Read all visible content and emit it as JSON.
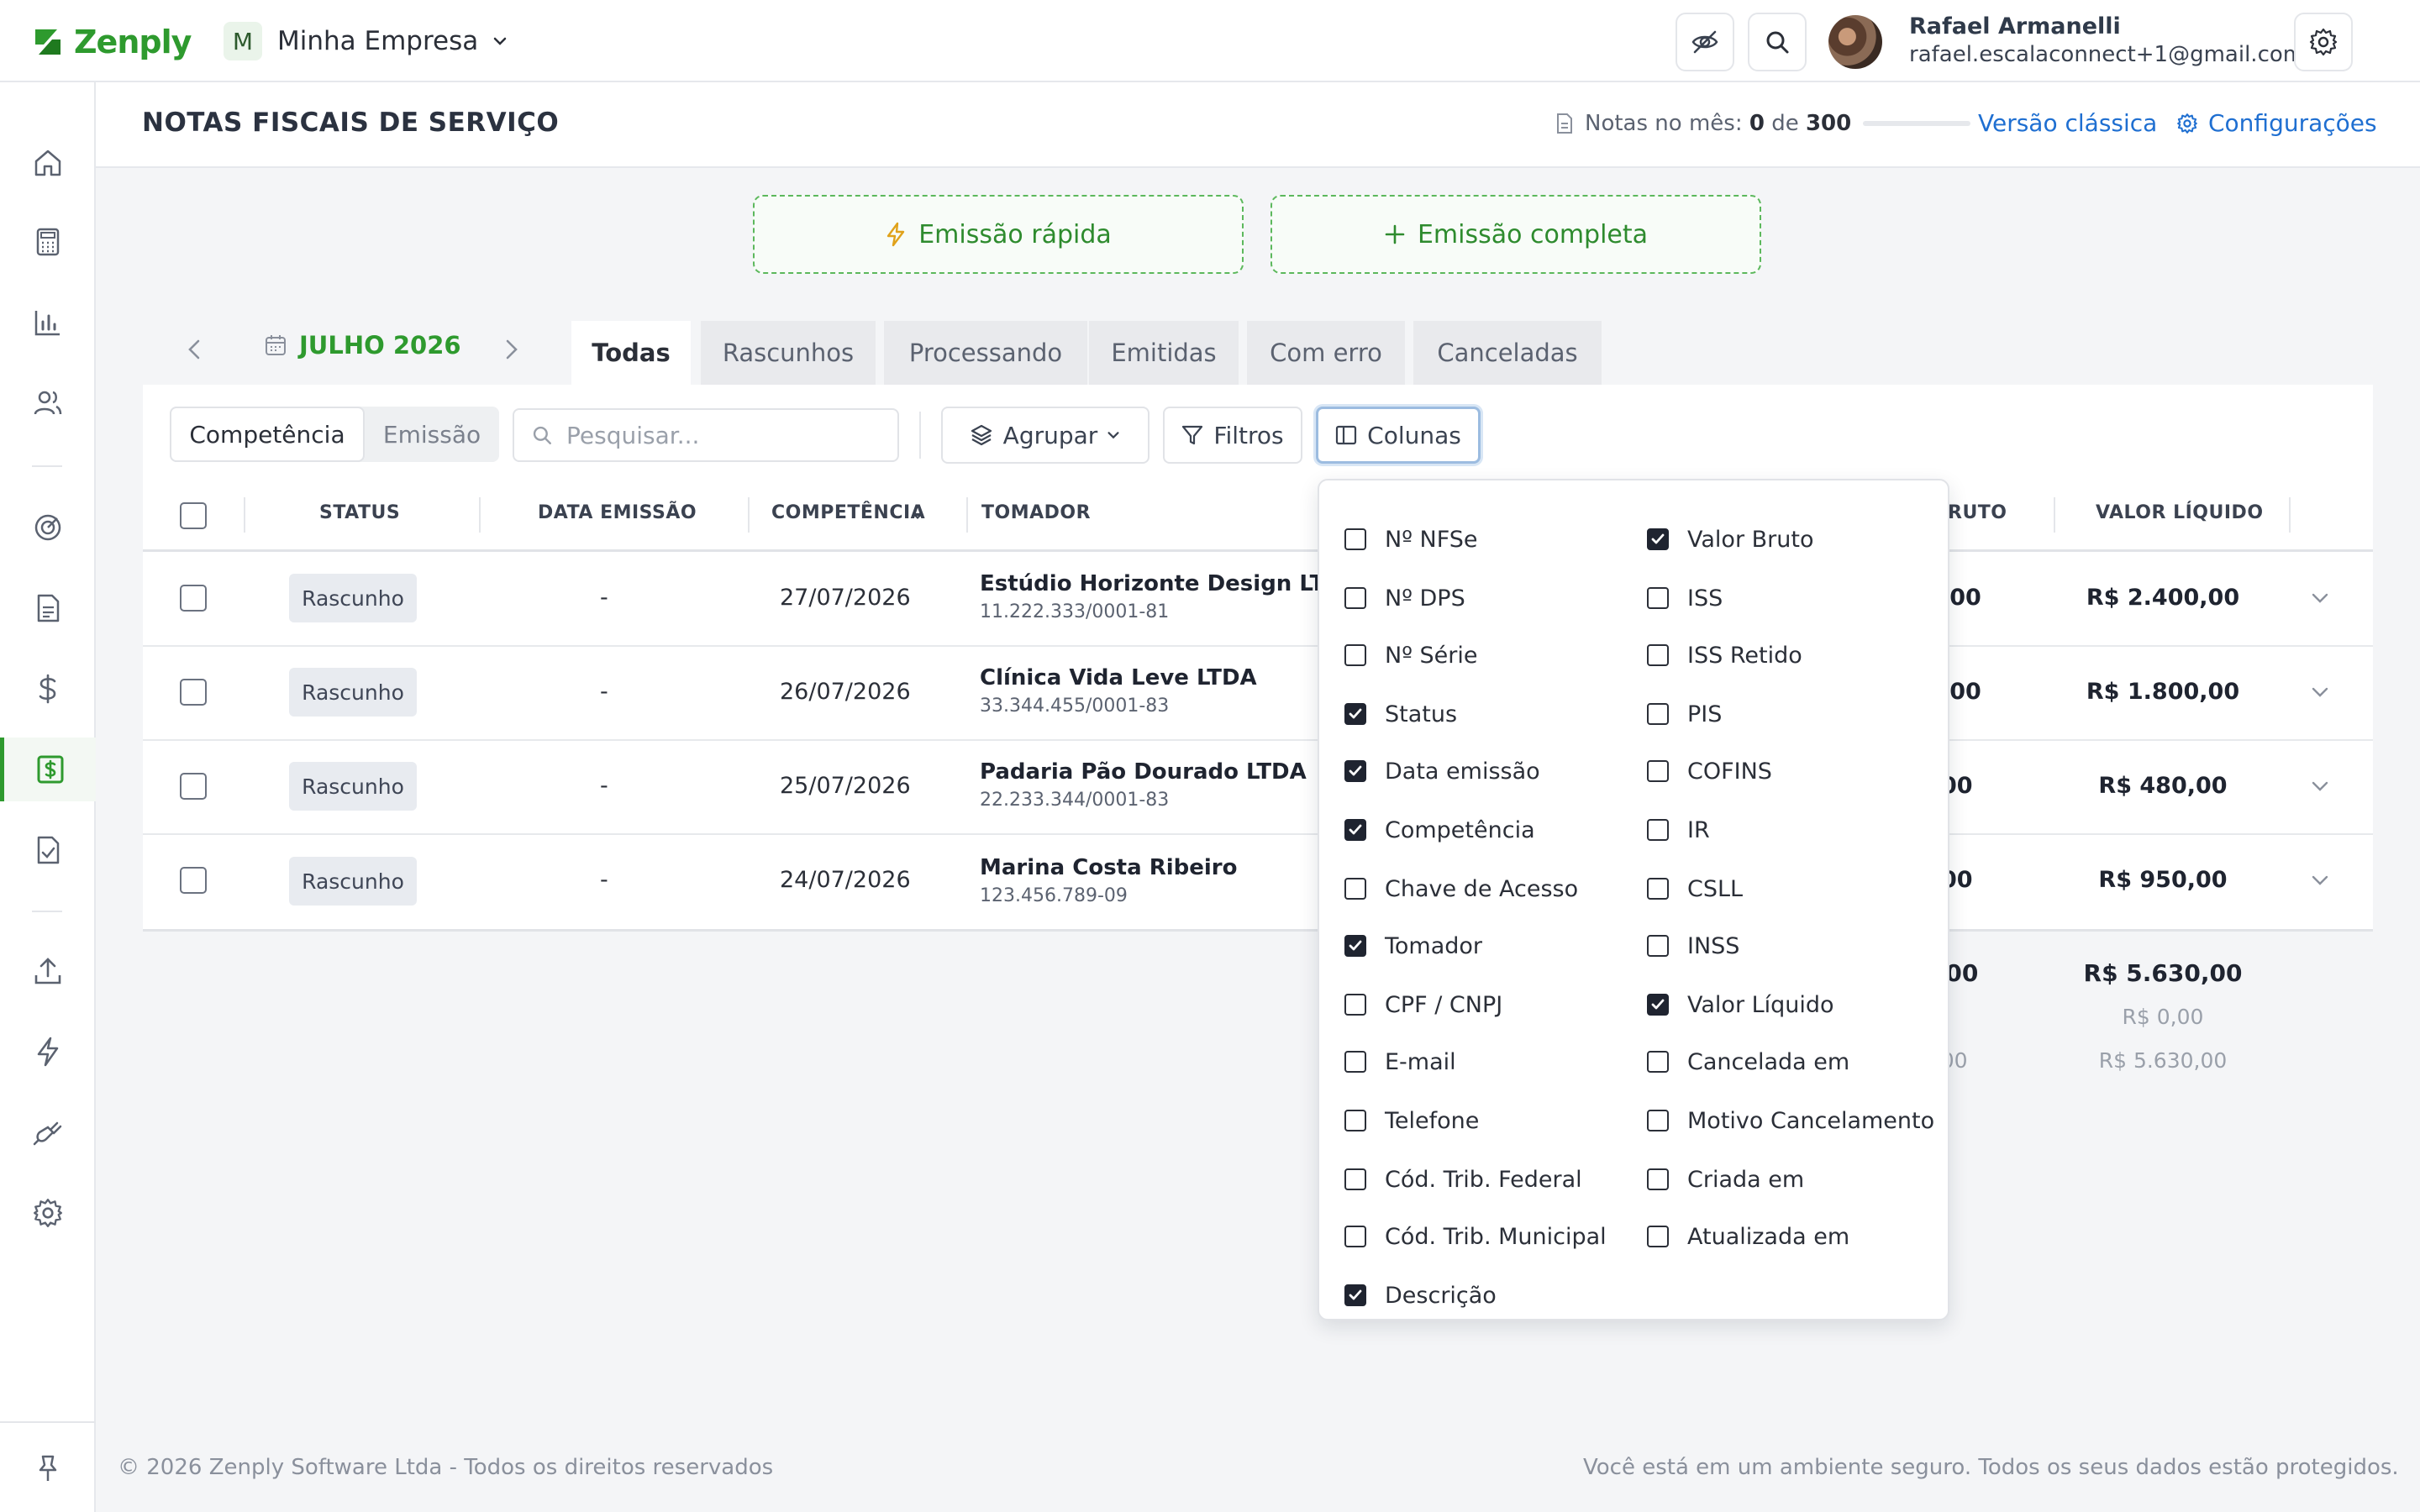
{
  "brand": {
    "name": "Zenply",
    "color": "#2e9a2e"
  },
  "company": {
    "initial": "M",
    "name": "Minha Empresa"
  },
  "user": {
    "name": "Rafael Armanelli",
    "email": "rafael.escalaconnect+1@gmail.com"
  },
  "header": {
    "title": "NOTAS FISCAIS DE SERVIÇO",
    "notes_prefix": "Notas no mês:",
    "notes_used": "0",
    "notes_of": "de",
    "notes_total": "300",
    "notes_progress": 0,
    "classic_link": "Versão clássica",
    "config_link": "Configurações"
  },
  "actions": {
    "quick": "Emissão rápida",
    "full": "Emissão completa"
  },
  "period": {
    "month": "JULHO 2026"
  },
  "tabs": [
    {
      "label": "Todas",
      "active": true
    },
    {
      "label": "Rascunhos"
    },
    {
      "label": "Processando"
    },
    {
      "label": "Emitidas"
    },
    {
      "label": "Com erro"
    },
    {
      "label": "Canceladas"
    }
  ],
  "toolbar": {
    "segment": [
      "Competência",
      "Emissão"
    ],
    "search_placeholder": "Pesquisar...",
    "group": "Agrupar",
    "filters": "Filtros",
    "columns": "Colunas"
  },
  "table": {
    "headers": {
      "status": "STATUS",
      "data_emissao": "DATA EMISSÃO",
      "competencia": "COMPETÊNCIA",
      "tomador": "TOMADOR",
      "valor_bruto_partial": "RUTO",
      "valor_liquido": "VALOR LÍQUIDO"
    },
    "rows": [
      {
        "status": "Rascunho",
        "data_emissao": "-",
        "competencia": "27/07/2026",
        "tomador": "Estúdio Horizonte Design LT...",
        "doc": "11.222.333/0001-81",
        "bruto_partial": ",00",
        "liquido": "R$ 2.400,00"
      },
      {
        "status": "Rascunho",
        "data_emissao": "-",
        "competencia": "26/07/2026",
        "tomador": "Clínica Vida Leve LTDA",
        "doc": "33.344.455/0001-83",
        "bruto_partial": ",00",
        "liquido": "R$ 1.800,00"
      },
      {
        "status": "Rascunho",
        "data_emissao": "-",
        "competencia": "25/07/2026",
        "tomador": "Padaria Pão Dourado LTDA",
        "doc": "22.233.344/0001-83",
        "bruto_partial": "00",
        "liquido": "R$ 480,00"
      },
      {
        "status": "Rascunho",
        "data_emissao": "-",
        "competencia": "24/07/2026",
        "tomador": "Marina Costa Ribeiro",
        "doc": "123.456.789-09",
        "bruto_partial": "00",
        "liquido": "R$ 950,00"
      }
    ],
    "totals": [
      {
        "bruto_partial": "),00",
        "liquido": "R$ 5.630,00"
      },
      {
        "bruto_partial": ")0",
        "liquido": "R$ 0,00"
      },
      {
        "bruto_partial": "),00",
        "liquido": "R$ 5.630,00"
      }
    ]
  },
  "columns_menu": {
    "left": [
      {
        "label": "Nº NFSe",
        "checked": false
      },
      {
        "label": "Nº DPS",
        "checked": false
      },
      {
        "label": "Nº Série",
        "checked": false
      },
      {
        "label": "Status",
        "checked": true
      },
      {
        "label": "Data emissão",
        "checked": true
      },
      {
        "label": "Competência",
        "checked": true
      },
      {
        "label": "Chave de Acesso",
        "checked": false
      },
      {
        "label": "Tomador",
        "checked": true
      },
      {
        "label": "CPF / CNPJ",
        "checked": false
      },
      {
        "label": "E-mail",
        "checked": false
      },
      {
        "label": "Telefone",
        "checked": false
      },
      {
        "label": "Cód. Trib. Federal",
        "checked": false
      },
      {
        "label": "Cód. Trib. Municipal",
        "checked": false
      },
      {
        "label": "Descrição",
        "checked": true
      }
    ],
    "right": [
      {
        "label": "Valor Bruto",
        "checked": true
      },
      {
        "label": "ISS",
        "checked": false
      },
      {
        "label": "ISS Retido",
        "checked": false
      },
      {
        "label": "PIS",
        "checked": false
      },
      {
        "label": "COFINS",
        "checked": false
      },
      {
        "label": "IR",
        "checked": false
      },
      {
        "label": "CSLL",
        "checked": false
      },
      {
        "label": "INSS",
        "checked": false
      },
      {
        "label": "Valor Líquido",
        "checked": true
      },
      {
        "label": "Cancelada em",
        "checked": false
      },
      {
        "label": "Motivo Cancelamento",
        "checked": false
      },
      {
        "label": "Criada em",
        "checked": false
      },
      {
        "label": "Atualizada em",
        "checked": false
      }
    ]
  },
  "footer": {
    "copyright": "© 2026 Zenply Software Ltda - Todos os direitos reservados",
    "security": "Você está em um ambiente seguro. Todos os seus dados estão protegidos."
  }
}
